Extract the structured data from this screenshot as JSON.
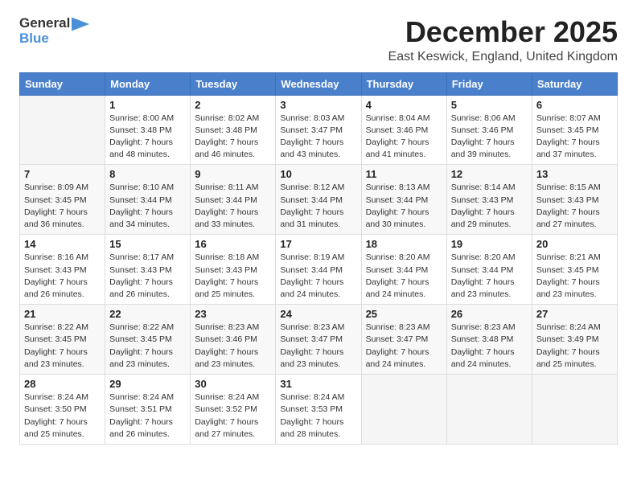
{
  "logo": {
    "general": "General",
    "blue": "Blue"
  },
  "header": {
    "month_title": "December 2025",
    "subtitle": "East Keswick, England, United Kingdom"
  },
  "days_of_week": [
    "Sunday",
    "Monday",
    "Tuesday",
    "Wednesday",
    "Thursday",
    "Friday",
    "Saturday"
  ],
  "weeks": [
    [
      {
        "day": "",
        "info": ""
      },
      {
        "day": "1",
        "info": "Sunrise: 8:00 AM\nSunset: 3:48 PM\nDaylight: 7 hours\nand 48 minutes."
      },
      {
        "day": "2",
        "info": "Sunrise: 8:02 AM\nSunset: 3:48 PM\nDaylight: 7 hours\nand 46 minutes."
      },
      {
        "day": "3",
        "info": "Sunrise: 8:03 AM\nSunset: 3:47 PM\nDaylight: 7 hours\nand 43 minutes."
      },
      {
        "day": "4",
        "info": "Sunrise: 8:04 AM\nSunset: 3:46 PM\nDaylight: 7 hours\nand 41 minutes."
      },
      {
        "day": "5",
        "info": "Sunrise: 8:06 AM\nSunset: 3:46 PM\nDaylight: 7 hours\nand 39 minutes."
      },
      {
        "day": "6",
        "info": "Sunrise: 8:07 AM\nSunset: 3:45 PM\nDaylight: 7 hours\nand 37 minutes."
      }
    ],
    [
      {
        "day": "7",
        "info": "Sunrise: 8:09 AM\nSunset: 3:45 PM\nDaylight: 7 hours\nand 36 minutes."
      },
      {
        "day": "8",
        "info": "Sunrise: 8:10 AM\nSunset: 3:44 PM\nDaylight: 7 hours\nand 34 minutes."
      },
      {
        "day": "9",
        "info": "Sunrise: 8:11 AM\nSunset: 3:44 PM\nDaylight: 7 hours\nand 33 minutes."
      },
      {
        "day": "10",
        "info": "Sunrise: 8:12 AM\nSunset: 3:44 PM\nDaylight: 7 hours\nand 31 minutes."
      },
      {
        "day": "11",
        "info": "Sunrise: 8:13 AM\nSunset: 3:44 PM\nDaylight: 7 hours\nand 30 minutes."
      },
      {
        "day": "12",
        "info": "Sunrise: 8:14 AM\nSunset: 3:43 PM\nDaylight: 7 hours\nand 29 minutes."
      },
      {
        "day": "13",
        "info": "Sunrise: 8:15 AM\nSunset: 3:43 PM\nDaylight: 7 hours\nand 27 minutes."
      }
    ],
    [
      {
        "day": "14",
        "info": "Sunrise: 8:16 AM\nSunset: 3:43 PM\nDaylight: 7 hours\nand 26 minutes."
      },
      {
        "day": "15",
        "info": "Sunrise: 8:17 AM\nSunset: 3:43 PM\nDaylight: 7 hours\nand 26 minutes."
      },
      {
        "day": "16",
        "info": "Sunrise: 8:18 AM\nSunset: 3:43 PM\nDaylight: 7 hours\nand 25 minutes."
      },
      {
        "day": "17",
        "info": "Sunrise: 8:19 AM\nSunset: 3:44 PM\nDaylight: 7 hours\nand 24 minutes."
      },
      {
        "day": "18",
        "info": "Sunrise: 8:20 AM\nSunset: 3:44 PM\nDaylight: 7 hours\nand 24 minutes."
      },
      {
        "day": "19",
        "info": "Sunrise: 8:20 AM\nSunset: 3:44 PM\nDaylight: 7 hours\nand 23 minutes."
      },
      {
        "day": "20",
        "info": "Sunrise: 8:21 AM\nSunset: 3:45 PM\nDaylight: 7 hours\nand 23 minutes."
      }
    ],
    [
      {
        "day": "21",
        "info": "Sunrise: 8:22 AM\nSunset: 3:45 PM\nDaylight: 7 hours\nand 23 minutes."
      },
      {
        "day": "22",
        "info": "Sunrise: 8:22 AM\nSunset: 3:45 PM\nDaylight: 7 hours\nand 23 minutes."
      },
      {
        "day": "23",
        "info": "Sunrise: 8:23 AM\nSunset: 3:46 PM\nDaylight: 7 hours\nand 23 minutes."
      },
      {
        "day": "24",
        "info": "Sunrise: 8:23 AM\nSunset: 3:47 PM\nDaylight: 7 hours\nand 23 minutes."
      },
      {
        "day": "25",
        "info": "Sunrise: 8:23 AM\nSunset: 3:47 PM\nDaylight: 7 hours\nand 24 minutes."
      },
      {
        "day": "26",
        "info": "Sunrise: 8:23 AM\nSunset: 3:48 PM\nDaylight: 7 hours\nand 24 minutes."
      },
      {
        "day": "27",
        "info": "Sunrise: 8:24 AM\nSunset: 3:49 PM\nDaylight: 7 hours\nand 25 minutes."
      }
    ],
    [
      {
        "day": "28",
        "info": "Sunrise: 8:24 AM\nSunset: 3:50 PM\nDaylight: 7 hours\nand 25 minutes."
      },
      {
        "day": "29",
        "info": "Sunrise: 8:24 AM\nSunset: 3:51 PM\nDaylight: 7 hours\nand 26 minutes."
      },
      {
        "day": "30",
        "info": "Sunrise: 8:24 AM\nSunset: 3:52 PM\nDaylight: 7 hours\nand 27 minutes."
      },
      {
        "day": "31",
        "info": "Sunrise: 8:24 AM\nSunset: 3:53 PM\nDaylight: 7 hours\nand 28 minutes."
      },
      {
        "day": "",
        "info": ""
      },
      {
        "day": "",
        "info": ""
      },
      {
        "day": "",
        "info": ""
      }
    ]
  ]
}
